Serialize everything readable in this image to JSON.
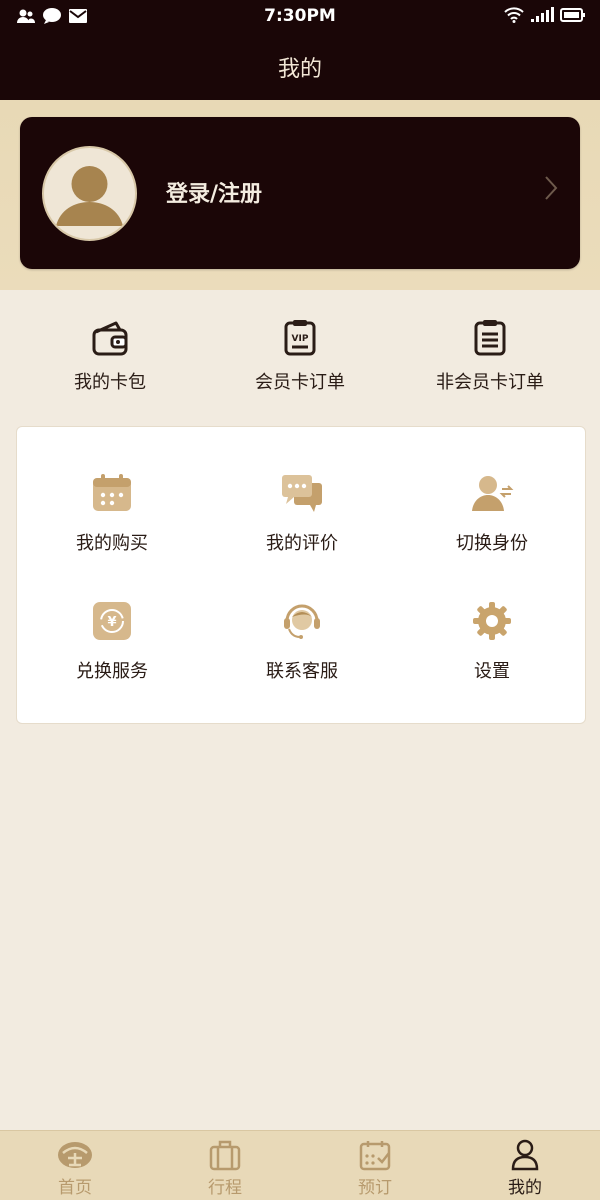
{
  "status_bar": {
    "time": "7:30PM"
  },
  "header": {
    "title": "我的"
  },
  "profile": {
    "login_label": "登录/注册"
  },
  "quick_actions": [
    {
      "label": "我的卡包",
      "icon": "wallet-icon"
    },
    {
      "label": "会员卡订单",
      "icon": "vip-order-icon"
    },
    {
      "label": "非会员卡订单",
      "icon": "clipboard-list-icon"
    }
  ],
  "services": [
    {
      "label": "我的购买",
      "icon": "calendar-icon"
    },
    {
      "label": "我的评价",
      "icon": "chat-bubbles-icon"
    },
    {
      "label": "切换身份",
      "icon": "switch-user-icon"
    },
    {
      "label": "兑换服务",
      "icon": "yen-exchange-icon"
    },
    {
      "label": "联系客服",
      "icon": "headset-icon"
    },
    {
      "label": "设置",
      "icon": "gear-icon"
    }
  ],
  "tab_bar": {
    "tabs": [
      {
        "label": "首页",
        "icon": "home-logo-icon"
      },
      {
        "label": "行程",
        "icon": "suitcase-icon"
      },
      {
        "label": "预订",
        "icon": "calendar-check-icon"
      },
      {
        "label": "我的",
        "icon": "user-icon"
      }
    ],
    "active_index": 3
  },
  "colors": {
    "dark_bg": "#1a0607",
    "gold": "#c9a46c",
    "page_bg": "#f2ebe0",
    "tab_bg": "#e8d9b8"
  }
}
